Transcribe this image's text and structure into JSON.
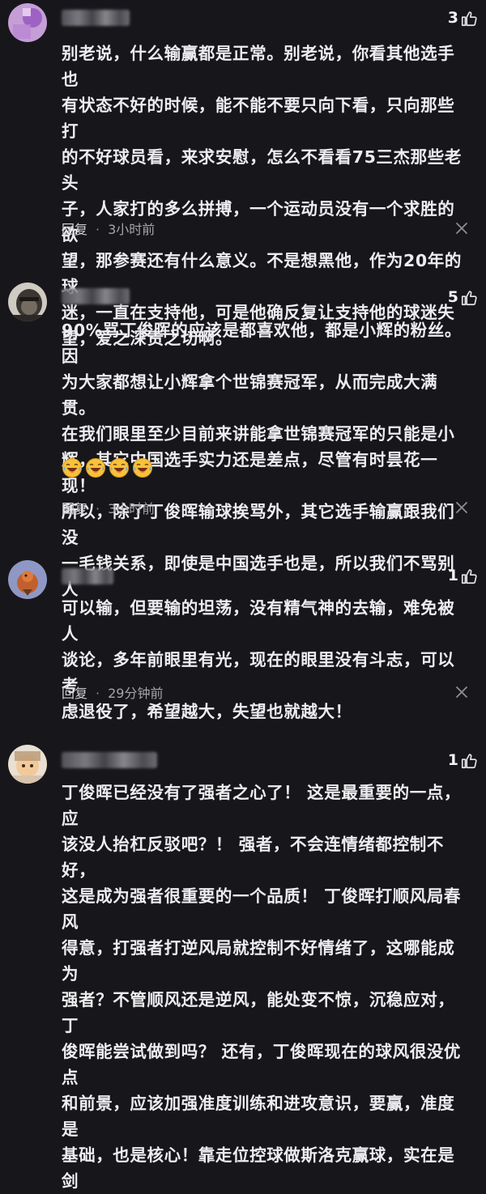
{
  "comments": [
    {
      "likes": "3",
      "text": "别老说，什么输赢都是正常。别老说，你看其他选手也\n有状态不好的时候，能不能不要只向下看，只向那些打\n的不好球员看，来求安慰，怎么不看看75三杰那些老头\n子，人家打的多么拼搏，一个运动员没有一个求胜的欲\n望，那参赛还有什么意义。不是想黑他，作为20年的球\n迷，一直在支持他，可是他确反复让支持他的球迷失\n望，爱之深责之切啊。",
      "reply_label": "回复",
      "time": "3小时前"
    },
    {
      "likes": "5",
      "text": "90%骂丁俊晖的应该是都喜欢他，都是小辉的粉丝。因\n为大家都想让小辉拿个世锦赛冠军，从而完成大满贯。\n在我们眼里至少目前来讲能拿世锦赛冠军的只能是小\n辉，其它中国选手实力还是差点，尽管有时昙花一现！\n所以，除了丁俊晖输球挨骂外，其它选手输赢跟我们没\n一毛钱关系，即使是中国选手也是，所以我们不骂别人",
      "emoji_name": "laughing-crying-emoji",
      "reply_label": "回复",
      "time": "3小时前"
    },
    {
      "likes": "1",
      "text": "可以输，但要输的坦荡，没有精气神的去输，难免被人\n谈论，多年前眼里有光，现在的眼里没有斗志，可以考\n虑退役了，希望越大，失望也就越大！",
      "reply_label": "回复",
      "time": "29分钟前"
    },
    {
      "likes": "1",
      "text": "丁俊晖已经没有了强者之心了！ 这是最重要的一点，应\n该没人抬杠反驳吧？！ 强者，不会连情绪都控制不好，\n这是成为强者很重要的一个品质！ 丁俊晖打顺风局春风\n得意，打强者打逆风局就控制不好情绪了，这哪能成为\n强者？不管顺风还是逆风，能处变不惊，沉稳应对，丁\n俊晖能尝试做到吗？ 还有，丁俊晖现在的球风很没优点\n和前景，应该加强准度训练和进攻意识，要赢，准度是\n基础，也是核心！靠走位控球做斯洛克赢球，实在是剑"
    }
  ],
  "colors": {
    "background": "#17171b",
    "text": "#ededf0",
    "meta": "#a4a4aa"
  },
  "icons": [
    "thumbs-up-icon",
    "close-icon"
  ]
}
